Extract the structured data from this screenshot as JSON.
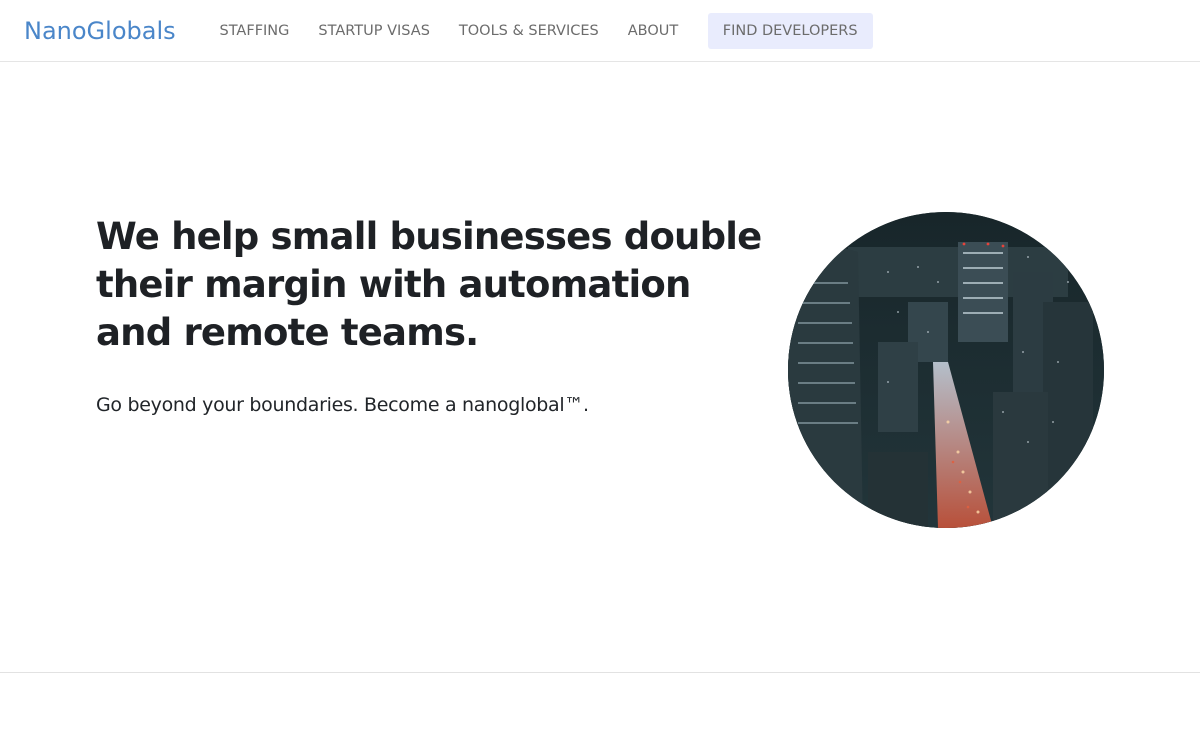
{
  "brand": {
    "name": "NanoGlobals"
  },
  "nav": {
    "items": [
      {
        "label": "STAFFING"
      },
      {
        "label": "STARTUP VISAS"
      },
      {
        "label": "TOOLS & SERVICES"
      },
      {
        "label": "ABOUT"
      }
    ],
    "cta_label": "FIND DEVELOPERS"
  },
  "hero": {
    "title": "We help small businesses double their margin with automation and remote teams.",
    "subtitle": "Go beyond your boundaries. Become a nanoglobal™.",
    "image_icon": "city-night-photo"
  },
  "colors": {
    "brand": "#4a86c9",
    "nav_text": "#6c6c6c",
    "cta_background": "#e9ecfd",
    "heading": "#1e2125"
  }
}
